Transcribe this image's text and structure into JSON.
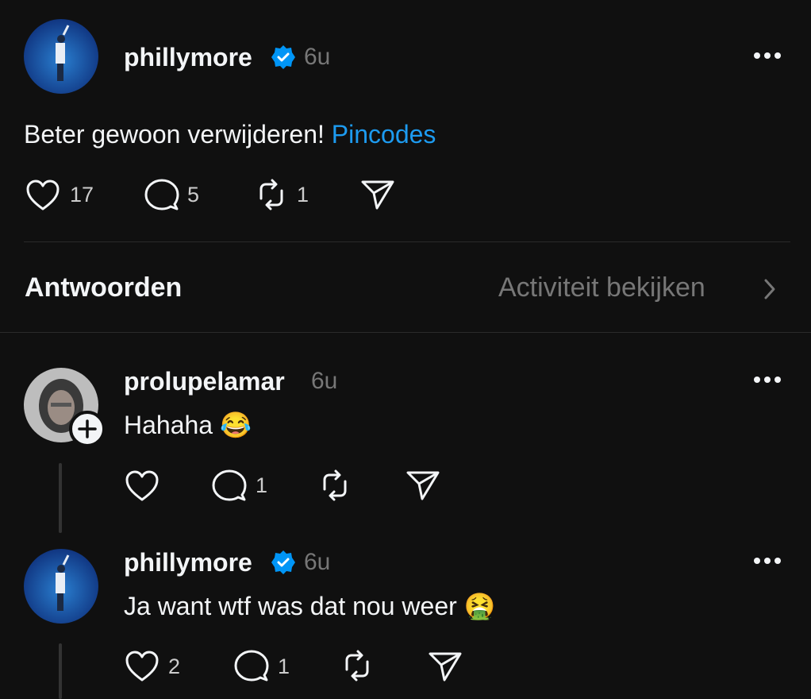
{
  "colors": {
    "background": "#101010",
    "verified": "#0095f6",
    "link": "#1d9bf0",
    "muted": "#777777"
  },
  "main_post": {
    "username": "phillymore",
    "verified": true,
    "time": "6u",
    "text": "Beter gewoon verwijderen!",
    "link_text": "Pincodes",
    "likes": "17",
    "replies": "5",
    "reposts": "1"
  },
  "replies_header": {
    "title": "Antwoorden",
    "activity_label": "Activiteit bekijken"
  },
  "replies": [
    {
      "username": "prolupelamar",
      "verified": false,
      "time": "6u",
      "text": "Hahaha",
      "emoji": "😂",
      "likes": "",
      "replies": "1",
      "reposts": ""
    },
    {
      "username": "phillymore",
      "verified": true,
      "time": "6u",
      "text": "Ja want wtf was dat nou weer",
      "emoji": "🤮",
      "likes": "2",
      "replies": "1",
      "reposts": ""
    }
  ],
  "icons": [
    "more-icon",
    "verified-icon",
    "heart-icon",
    "comment-icon",
    "repost-icon",
    "share-icon",
    "chevron-right-icon",
    "follow-plus-icon"
  ]
}
